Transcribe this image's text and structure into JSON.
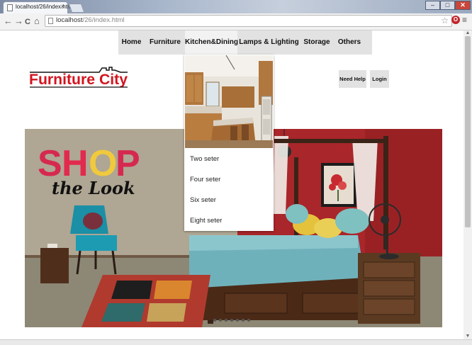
{
  "browser": {
    "tab_title": "localhost/26/index.html",
    "tab_close": "×",
    "url_host": "localhost",
    "url_path": "/26/index.html",
    "nav_back": "←",
    "nav_forward": "→",
    "nav_reload": "C",
    "nav_home": "⌂",
    "bookmark_star": "☆",
    "menu_icon": "≡",
    "extension_icon": "O",
    "win_min": "–",
    "win_max": "□",
    "win_close": "✕"
  },
  "nav": {
    "items": [
      {
        "label": "Home"
      },
      {
        "label": "Furniture"
      },
      {
        "label": "Kitchen&Dining"
      },
      {
        "label": "Lamps & Lighting"
      },
      {
        "label": "Storage"
      },
      {
        "label": "Others"
      }
    ],
    "active_index": 2
  },
  "logo": {
    "text": "Furniture City",
    "color": "#d4141f"
  },
  "header_buttons": {
    "help": "Need Help",
    "login": "Login"
  },
  "dropdown": {
    "items": [
      {
        "label": "Two seter"
      },
      {
        "label": "Four seter"
      },
      {
        "label": "Six seter"
      },
      {
        "label": "Eight seter"
      }
    ]
  },
  "hero": {
    "shop_letters": [
      "S",
      "H",
      "O",
      "P"
    ],
    "shop_colors": [
      "#d6294f",
      "#e2294e",
      "#f0c93d",
      "#d6294f"
    ],
    "tagline": "the Look"
  },
  "colors": {
    "nav_bg": "#e2e2e2",
    "nav_active_bg": "#f2f2f2",
    "wall_red": "#a9262a"
  }
}
